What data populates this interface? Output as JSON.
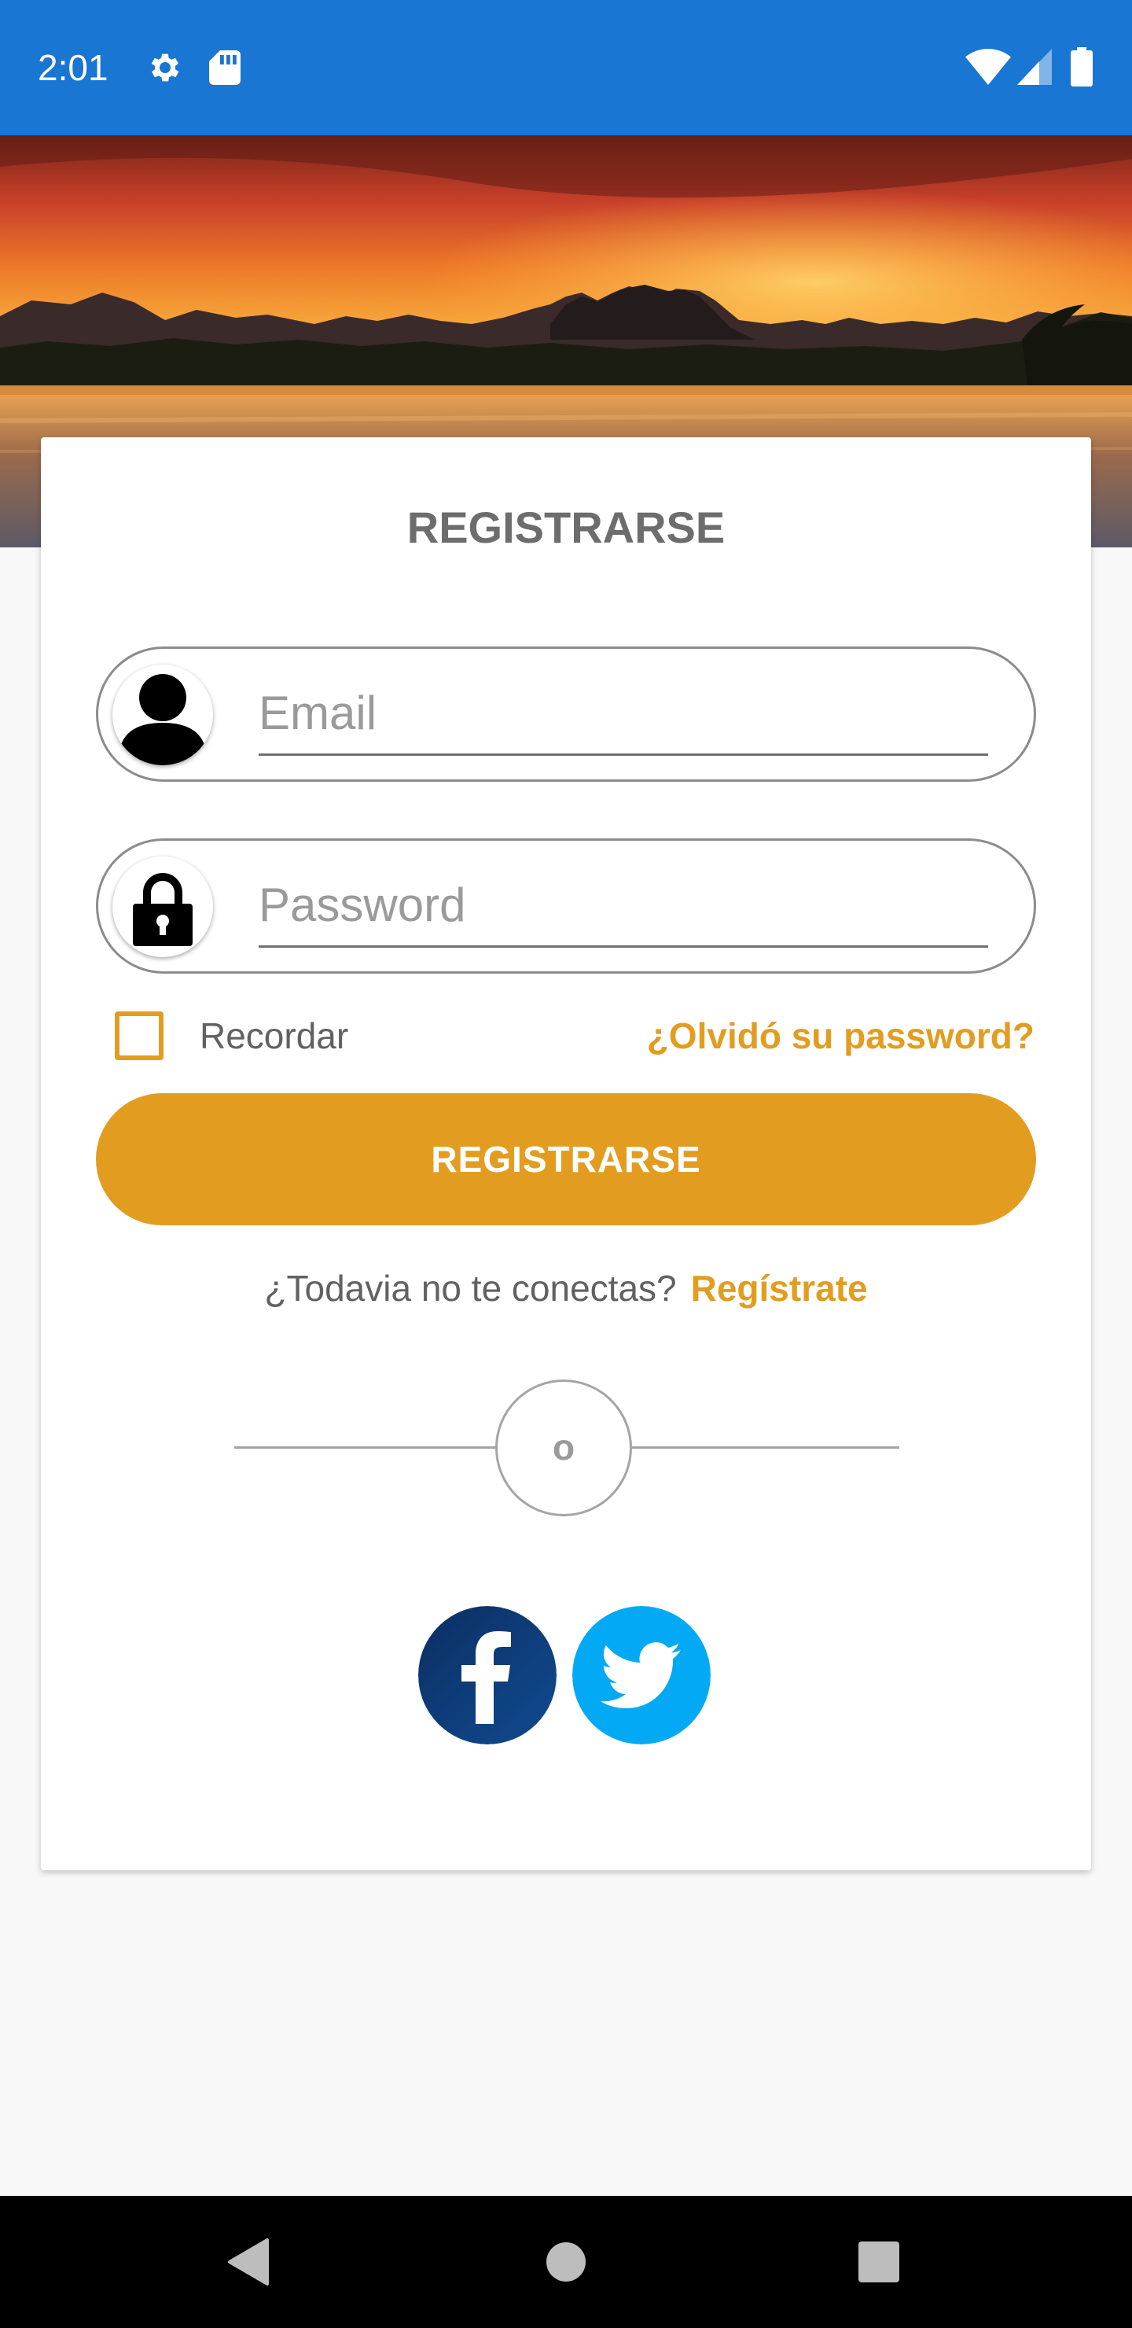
{
  "status_bar": {
    "time": "2:01",
    "icons": [
      "settings-gear-icon",
      "sd-card-icon",
      "wifi-icon",
      "signal-icon",
      "battery-icon"
    ],
    "background": "#1976d2"
  },
  "card": {
    "title": "REGISTRARSE",
    "email": {
      "placeholder": "Email",
      "value": "",
      "icon": "user-icon"
    },
    "password": {
      "placeholder": "Password",
      "value": "",
      "icon": "lock-icon"
    },
    "remember_label": "Recordar",
    "remember_checked": false,
    "forgot_label": "¿Olvidó su password?",
    "register_button": "REGISTRARSE",
    "signup_prompt": "¿Todavia no te conectas?",
    "signup_link": "Regístrate",
    "divider_text": "o",
    "social": [
      "facebook-icon",
      "twitter-icon"
    ]
  },
  "colors": {
    "accent": "#e29d21",
    "facebook": "#0d3c78",
    "twitter": "#03a9f4",
    "title_gray": "#6d6d6d"
  },
  "nav_bar": {
    "buttons": [
      "back-icon",
      "home-icon",
      "recents-icon"
    ]
  }
}
